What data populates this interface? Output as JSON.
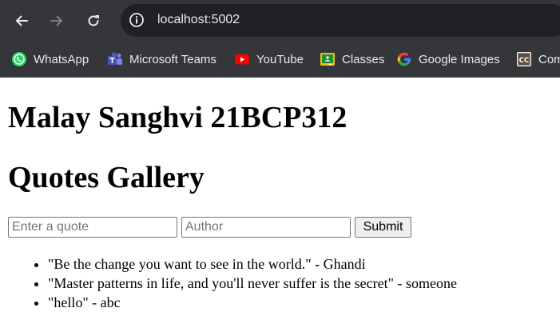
{
  "browser": {
    "url": "localhost:5002",
    "bookmarks": [
      {
        "label": "WhatsApp",
        "icon": "whatsapp-icon"
      },
      {
        "label": "Microsoft Teams",
        "icon": "teams-icon"
      },
      {
        "label": "YouTube",
        "icon": "youtube-icon"
      },
      {
        "label": "Classes",
        "icon": "classroom-icon"
      },
      {
        "label": "Google Images",
        "icon": "google-icon"
      },
      {
        "label": "Com",
        "icon": "cc-icon"
      }
    ],
    "colors": {
      "chrome": "#35363a",
      "omnibox": "#202124",
      "text": "#e8eaed"
    }
  },
  "page": {
    "heading": "Malay Sanghvi 21BCP312",
    "subheading": "Quotes Gallery",
    "form": {
      "quote_placeholder": "Enter a quote",
      "quote_value": "",
      "author_placeholder": "Author",
      "author_value": "",
      "submit_label": "Submit"
    },
    "quotes": [
      {
        "text": "\"Be the change you want to see in the world.\" - Ghandi"
      },
      {
        "text": "\"Master patterns in life, and you'll never suffer is the secret\" - someone"
      },
      {
        "text": "\"hello\" - abc"
      }
    ]
  }
}
